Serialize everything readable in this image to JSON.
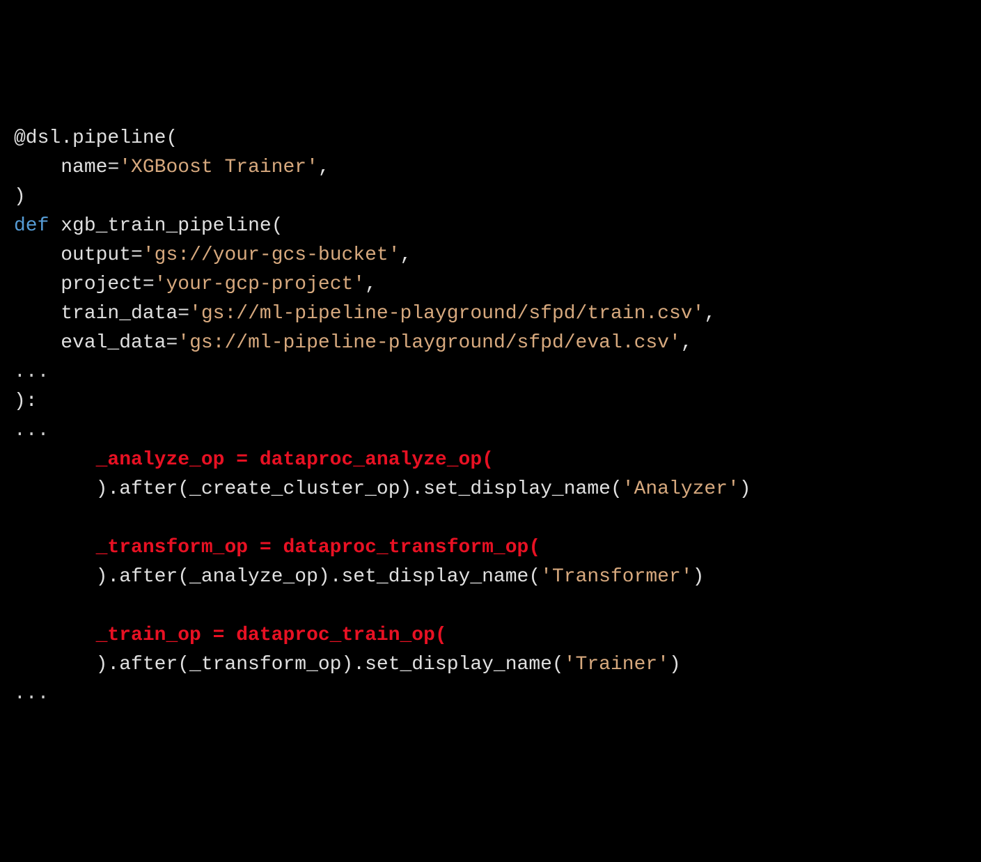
{
  "line1": {
    "decorator": "@dsl.pipeline(",
    "indent": ""
  },
  "line2": {
    "param": "name",
    "eq": "=",
    "str": "'XGBoost Trainer'",
    "comma": ","
  },
  "line3": {
    "paren": ")"
  },
  "line4": {
    "def": "def",
    "space": " ",
    "fn": "xgb_train_pipeline",
    "paren": "("
  },
  "line5": {
    "param": "output",
    "eq": "=",
    "str": "'gs://your-gcs-bucket'",
    "comma": ","
  },
  "line6": {
    "param": "project",
    "eq": "=",
    "str": "'your-gcp-project'",
    "comma": ","
  },
  "line7": {
    "param": "train_data",
    "eq": "=",
    "str": "'gs://ml-pipeline-playground/sfpd/train.csv'",
    "comma": ","
  },
  "line8": {
    "param": "eval_data",
    "eq": "=",
    "str": "'gs://ml-pipeline-playground/sfpd/eval.csv'",
    "comma": ","
  },
  "line9": {
    "ellipsis": "..."
  },
  "line10": {
    "close": "):"
  },
  "line11": {
    "ellipsis": "..."
  },
  "line12": {
    "red": "_analyze_op = dataproc_analyze_op("
  },
  "line13": {
    "close": ").after(",
    "arg": "_create_cluster_op",
    "mid": ").set_display_name(",
    "str": "'Analyzer'",
    "end": ")"
  },
  "line14": {
    "red": "_transform_op = dataproc_transform_op("
  },
  "line15": {
    "close": ").after(",
    "arg": "_analyze_op",
    "mid": ").set_display_name(",
    "str": "'Transformer'",
    "end": ")"
  },
  "line16": {
    "red": "_train_op = dataproc_train_op("
  },
  "line17": {
    "close": ").after(",
    "arg": "_transform_op",
    "mid": ").set_display_name(",
    "str": "'Trainer'",
    "end": ")"
  },
  "line18": {
    "ellipsis": "..."
  }
}
